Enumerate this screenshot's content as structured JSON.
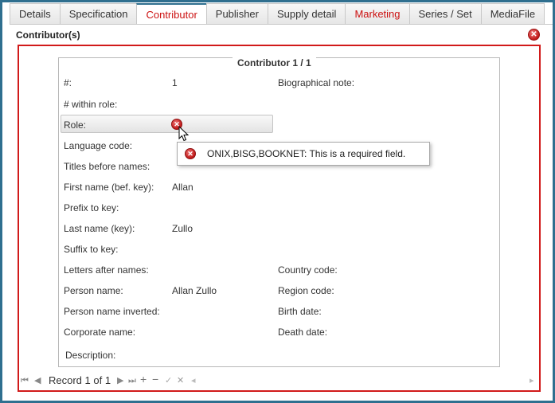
{
  "tabs": [
    {
      "label": "Details",
      "state": "normal"
    },
    {
      "label": "Specification",
      "state": "normal"
    },
    {
      "label": "Contributor",
      "state": "active"
    },
    {
      "label": "Publisher",
      "state": "normal"
    },
    {
      "label": "Supply detail",
      "state": "normal"
    },
    {
      "label": "Marketing",
      "state": "red"
    },
    {
      "label": "Series / Set",
      "state": "normal"
    },
    {
      "label": "MediaFile",
      "state": "normal"
    }
  ],
  "panel": {
    "title": "Contributor(s)",
    "close_icon": "close-icon"
  },
  "contributor": {
    "legend": "Contributor 1 / 1",
    "fields": {
      "number": {
        "label": "#:",
        "value": "1"
      },
      "number_within_role": {
        "label": "# within role:"
      },
      "role": {
        "label": "Role:"
      },
      "language_code": {
        "label": "Language code:"
      },
      "titles_before_names": {
        "label": "Titles before names:"
      },
      "first_name": {
        "label": "First name (bef. key):",
        "value": "Allan"
      },
      "prefix_to_key": {
        "label": "Prefix to key:"
      },
      "last_name": {
        "label": "Last name (key):",
        "value": "Zullo"
      },
      "suffix_to_key": {
        "label": "Suffix to key:"
      },
      "letters_after_names": {
        "label": "Letters after names:"
      },
      "person_name": {
        "label": "Person name:",
        "value": "Allan Zullo"
      },
      "person_name_inverted": {
        "label": "Person name inverted:"
      },
      "corporate_name": {
        "label": "Corporate name:"
      },
      "description": {
        "label": "Description:"
      },
      "biographical_note": {
        "label": "Biographical note:"
      },
      "country_code": {
        "label": "Country code:"
      },
      "region_code": {
        "label": "Region code:"
      },
      "birth_date": {
        "label": "Birth date:"
      },
      "death_date": {
        "label": "Death date:"
      }
    }
  },
  "validation": {
    "message": "ONIX,BISG,BOOKNET: This is a required field.",
    "error_color": "#c01818"
  },
  "toolbar": {
    "first": "⏮",
    "prev": "◀",
    "record_label": "Record 1 of 1",
    "next": "▶",
    "last": "⏭",
    "add": "+",
    "remove": "−",
    "confirm": "✓",
    "cancel": "✕",
    "scroll_left": "◂",
    "scroll_right": "▸"
  },
  "colors": {
    "accent": "#2f6f8f",
    "active_tab_text": "#cc1111",
    "error_border": "#d11a1a"
  }
}
